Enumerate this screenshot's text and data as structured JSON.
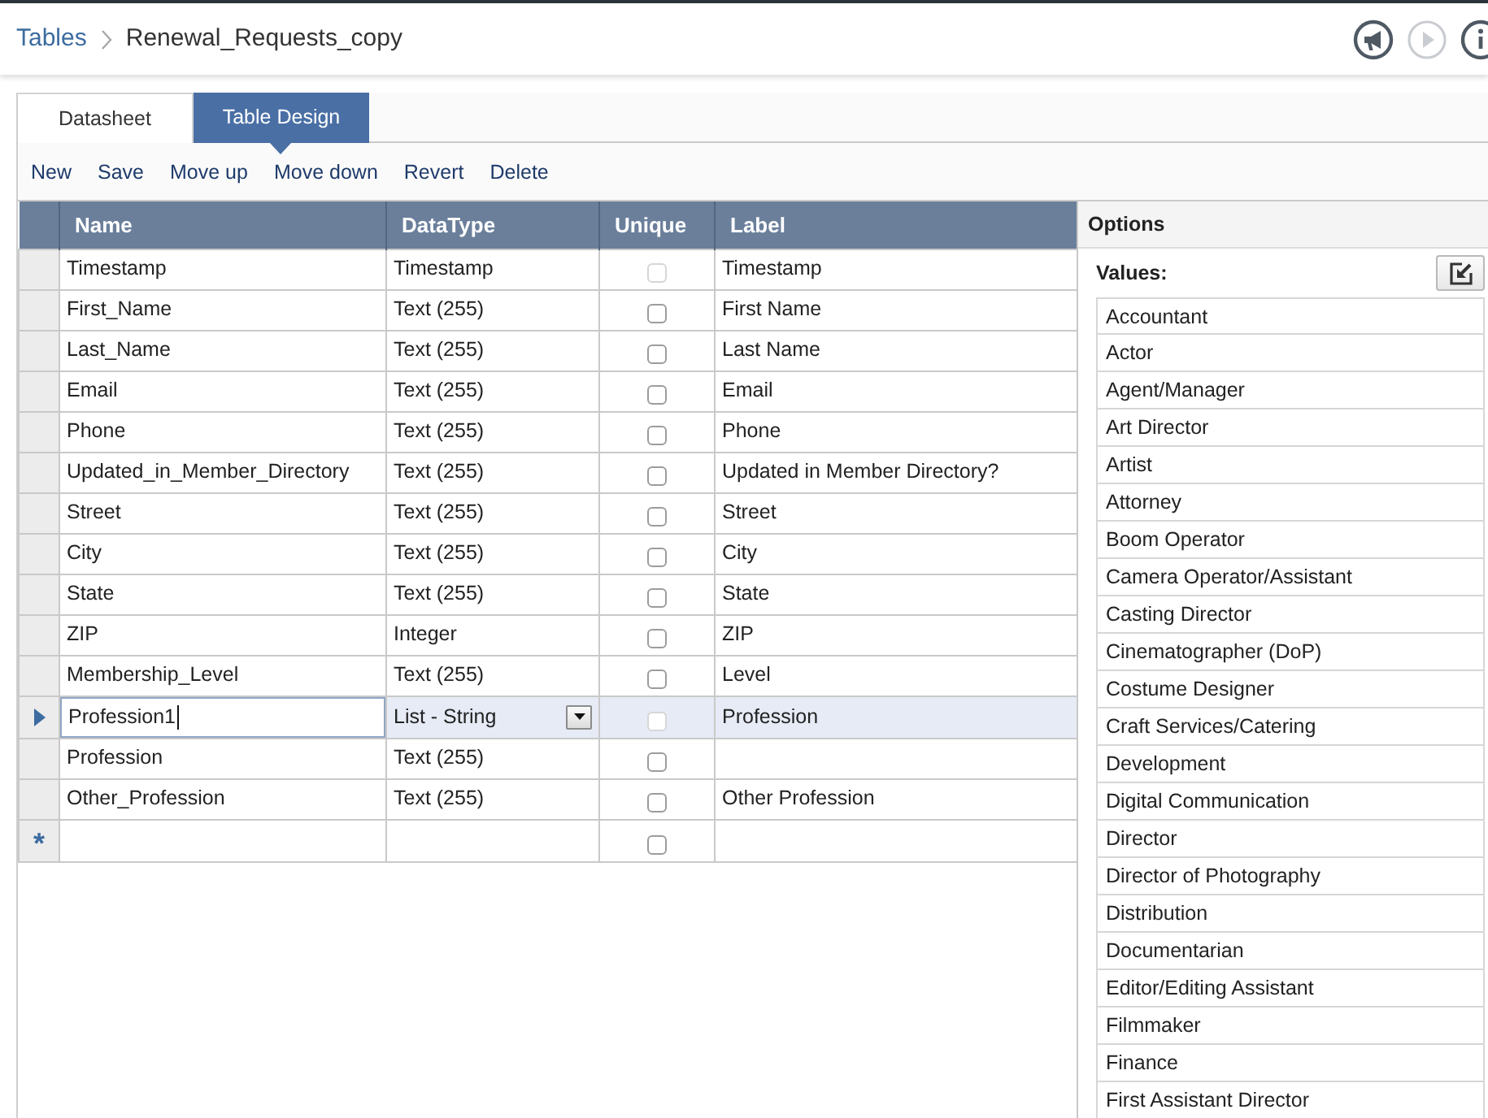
{
  "breadcrumb": {
    "root": "Tables",
    "current": "Renewal_Requests_copy"
  },
  "header_actions": [
    {
      "kind": "announcements",
      "disabled": false
    },
    {
      "kind": "run",
      "disabled": true
    },
    {
      "kind": "info",
      "disabled": false
    }
  ],
  "tabs": [
    {
      "label": "Datasheet",
      "selected": false
    },
    {
      "label": "Table Design",
      "selected": true
    }
  ],
  "toolbar": [
    "New",
    "Save",
    "Move up",
    "Move down",
    "Revert",
    "Delete"
  ],
  "table": {
    "columns": [
      "Name",
      "DataType",
      "Unique",
      "Label"
    ],
    "rows": [
      {
        "name": "Timestamp",
        "data_type": "Timestamp",
        "unique": {
          "checked": false,
          "disabled": true
        },
        "label": "Timestamp",
        "selected": false
      },
      {
        "name": "First_Name",
        "data_type": "Text (255)",
        "unique": {
          "checked": false,
          "disabled": false
        },
        "label": "First Name",
        "selected": false
      },
      {
        "name": "Last_Name",
        "data_type": "Text (255)",
        "unique": {
          "checked": false,
          "disabled": false
        },
        "label": "Last Name",
        "selected": false
      },
      {
        "name": "Email",
        "data_type": "Text (255)",
        "unique": {
          "checked": false,
          "disabled": false
        },
        "label": "Email",
        "selected": false
      },
      {
        "name": "Phone",
        "data_type": "Text (255)",
        "unique": {
          "checked": false,
          "disabled": false
        },
        "label": "Phone",
        "selected": false
      },
      {
        "name": "Updated_in_Member_Directory",
        "data_type": "Text (255)",
        "unique": {
          "checked": false,
          "disabled": false
        },
        "label": "Updated in Member Directory?",
        "selected": false
      },
      {
        "name": "Street",
        "data_type": "Text (255)",
        "unique": {
          "checked": false,
          "disabled": false
        },
        "label": "Street",
        "selected": false
      },
      {
        "name": "City",
        "data_type": "Text (255)",
        "unique": {
          "checked": false,
          "disabled": false
        },
        "label": "City",
        "selected": false
      },
      {
        "name": "State",
        "data_type": "Text (255)",
        "unique": {
          "checked": false,
          "disabled": false
        },
        "label": "State",
        "selected": false
      },
      {
        "name": "ZIP",
        "data_type": "Integer",
        "unique": {
          "checked": false,
          "disabled": false
        },
        "label": "ZIP",
        "selected": false
      },
      {
        "name": "Membership_Level",
        "data_type": "Text (255)",
        "unique": {
          "checked": false,
          "disabled": false
        },
        "label": "Level",
        "selected": false
      },
      {
        "name": "Profession1",
        "data_type": "List - String",
        "unique": {
          "checked": false,
          "disabled": true
        },
        "label": "Profession",
        "selected": true
      },
      {
        "name": "Profession",
        "data_type": "Text (255)",
        "unique": {
          "checked": false,
          "disabled": false
        },
        "selected": false
      },
      {
        "name": "Other_Profession",
        "data_type": "Text (255)",
        "unique": {
          "checked": false,
          "disabled": false
        },
        "label": "Other Profession",
        "selected": false
      }
    ],
    "new_row": {
      "marker": "*",
      "unique": {
        "checked": false,
        "disabled": false
      }
    }
  },
  "options": {
    "title": "Options",
    "values_label": "Values:",
    "values": [
      "Accountant",
      "Actor",
      "Agent/Manager",
      "Art Director",
      "Artist",
      "Attorney",
      "Boom Operator",
      "Camera Operator/Assistant",
      "Casting Director",
      "Cinematographer (DoP)",
      "Costume Designer",
      "Craft Services/Catering",
      "Development",
      "Digital Communication",
      "Director",
      "Director of Photography",
      "Distribution",
      "Documentarian",
      "Editor/Editing Assistant",
      "Filmmaker",
      "Finance",
      "First Assistant Director"
    ]
  }
}
